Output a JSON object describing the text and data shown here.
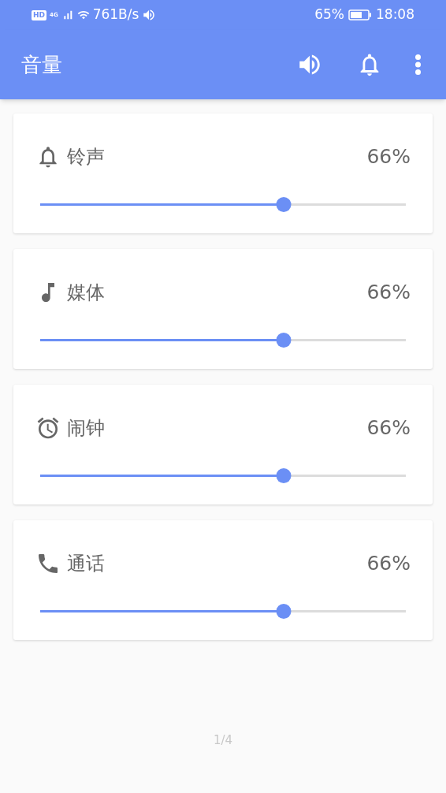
{
  "status_bar": {
    "hd": "HD",
    "network": "4G",
    "speed": "761B/s",
    "battery": "65%",
    "time": "18:08"
  },
  "app_bar": {
    "title": "音量"
  },
  "channels": [
    {
      "kind": "ring",
      "name": "铃声",
      "reading": "66%",
      "level": 0.666
    },
    {
      "kind": "media",
      "name": "媒体",
      "reading": "66%",
      "level": 0.666
    },
    {
      "kind": "alarm",
      "name": "闹钟",
      "reading": "66%",
      "level": 0.666
    },
    {
      "kind": "call",
      "name": "通话",
      "reading": "66%",
      "level": 0.666
    }
  ],
  "page_indicator": "1/4"
}
